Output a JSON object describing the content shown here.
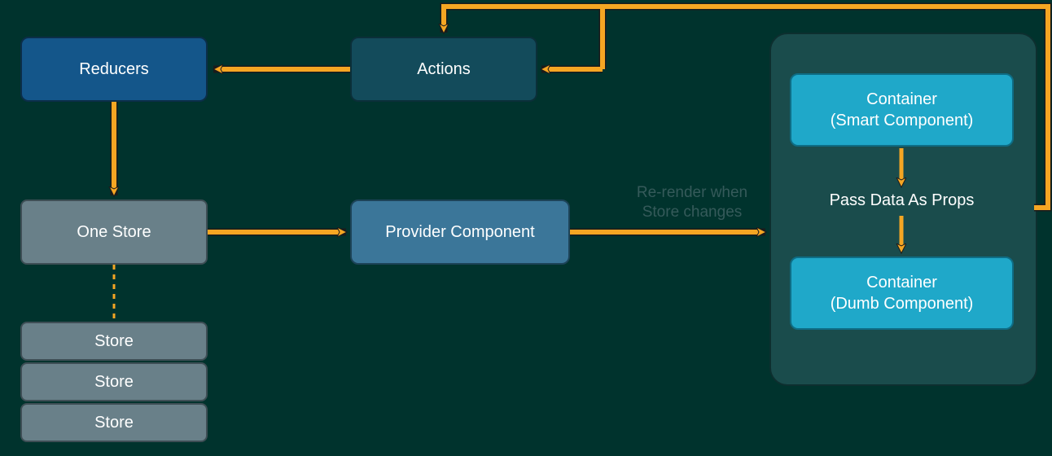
{
  "nodes": {
    "reducers": "Reducers",
    "actions": "Actions",
    "one_store": "One Store",
    "store_stack": [
      "Store",
      "Store",
      "Store"
    ],
    "provider": "Provider Component",
    "smart_line1": "Container",
    "smart_line2": "(Smart Component)",
    "dumb_line1": "Container",
    "dumb_line2": "(Dumb Component)",
    "pass_data": "Pass Data As Props"
  },
  "annotations": {
    "rerender_line1": "Re-render when",
    "rerender_line2": "Store changes"
  },
  "colors": {
    "bg": "#00332d",
    "arrow": "#f5a623",
    "arrow_border": "#1b1b1b",
    "panel": "#1a4c4c",
    "cyan": "#1fa8c9"
  }
}
